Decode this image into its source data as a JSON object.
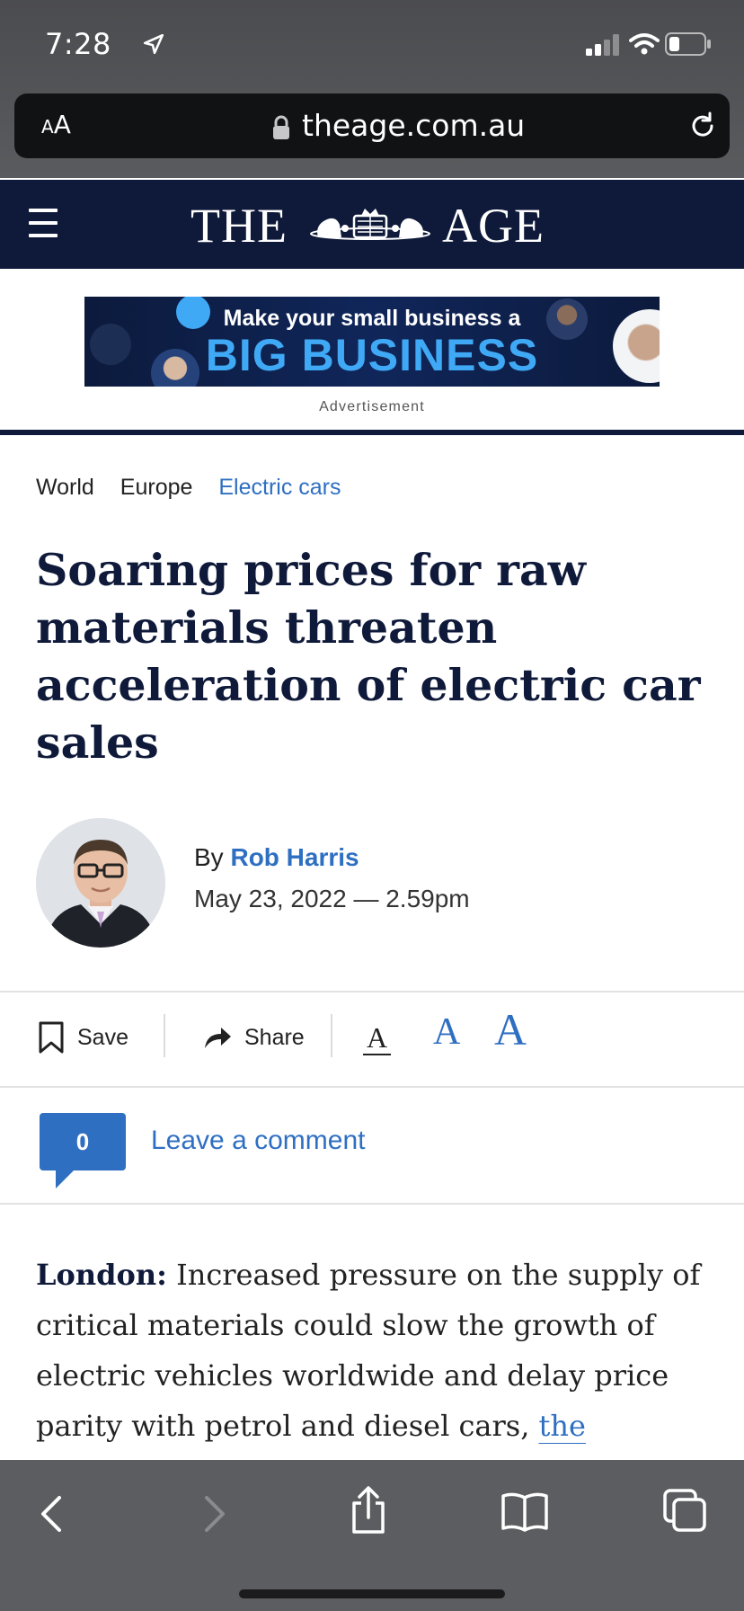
{
  "status_bar": {
    "time": "7:28"
  },
  "url_bar": {
    "text_size_small": "A",
    "text_size_large": "A",
    "domain": "theage.com.au"
  },
  "masthead": {
    "brand_left": "THE",
    "brand_right": "AGE",
    "color": "#0f1a3a"
  },
  "advertisement": {
    "line1": "Make your small business a",
    "line2": "BIG BUSINESS",
    "label": "Advertisement"
  },
  "breadcrumbs": [
    {
      "label": "World"
    },
    {
      "label": "Europe"
    },
    {
      "label": "Electric cars"
    }
  ],
  "article": {
    "headline": "Soaring prices for raw materials threaten acceleration of electric car sales",
    "byline_prefix": "By ",
    "author": "Rob Harris",
    "date": "May 23, 2022 — 2.59pm",
    "accent_color": "#2f6fc2"
  },
  "toolbar": {
    "save_label": "Save",
    "share_label": "Share",
    "font_small": "A",
    "font_medium": "A",
    "font_large": "A"
  },
  "comments": {
    "count": "0",
    "link_label": "Leave a comment"
  },
  "body": {
    "lead": "London:",
    "text": " Increased pressure on the supply of critical materials could slow the growth of electric vehicles worldwide and delay price parity with petrol and diesel cars, ",
    "link_text": "the International"
  },
  "bottom_toolbar": {
    "icons": [
      "back-icon",
      "forward-icon",
      "share-icon",
      "bookmarks-icon",
      "tabs-icon"
    ]
  }
}
